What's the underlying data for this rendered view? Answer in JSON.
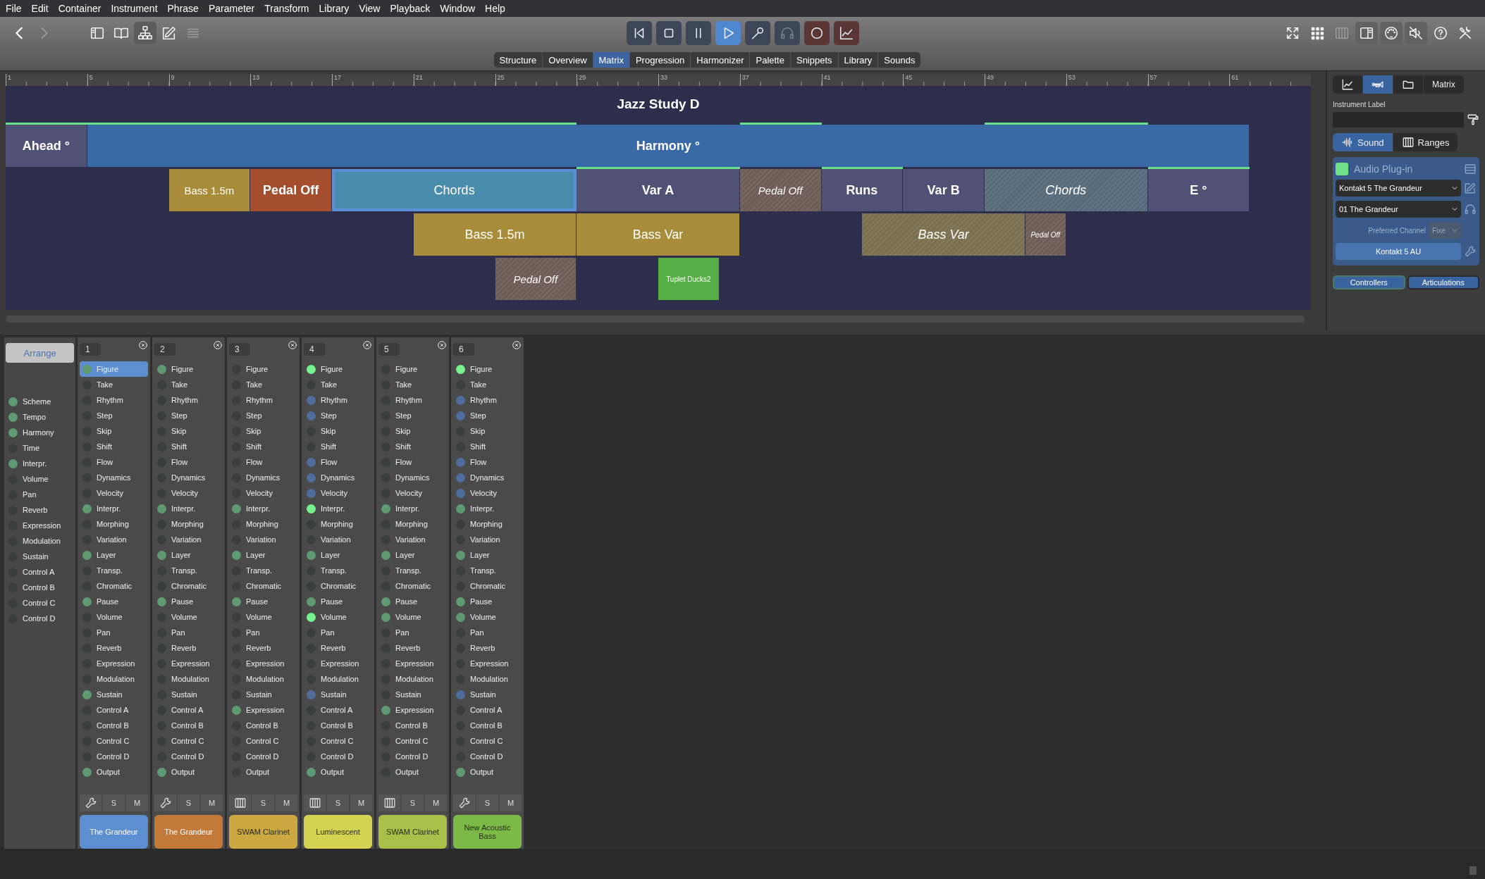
{
  "menu_bar": [
    "File",
    "Edit",
    "Container",
    "Instrument",
    "Phrase",
    "Parameter",
    "Transform",
    "Library",
    "View",
    "Playback",
    "Window",
    "Help"
  ],
  "toolbar": {
    "nav": [
      {
        "disabled": false
      },
      {
        "disabled": true
      }
    ],
    "view_buttons": [
      {
        "selected": false,
        "disabled": false
      },
      {
        "selected": false,
        "disabled": false
      },
      {
        "selected": true,
        "disabled": false
      },
      {
        "selected": false,
        "disabled": false
      },
      {
        "selected": false,
        "disabled": true
      }
    ],
    "transport": [
      {
        "selected": false,
        "disabled": false,
        "armed": false
      },
      {
        "selected": false,
        "disabled": false,
        "armed": false
      },
      {
        "selected": false,
        "disabled": false,
        "armed": false
      },
      {
        "selected": true,
        "disabled": false,
        "armed": false
      },
      {
        "selected": false,
        "disabled": false,
        "armed": false
      },
      {
        "selected": false,
        "disabled": true,
        "armed": false
      },
      {
        "selected": false,
        "disabled": false,
        "armed": true
      },
      {
        "selected": false,
        "disabled": false,
        "armed": true
      }
    ],
    "right_buttons": [
      {
        "selected": false,
        "disabled": false
      },
      {
        "selected": false,
        "disabled": false
      },
      {
        "selected": false,
        "disabled": true
      },
      {
        "selected": true,
        "disabled": false
      },
      {
        "selected": true,
        "disabled": false
      },
      {
        "selected": true,
        "disabled": false
      },
      {
        "selected": false,
        "disabled": false
      },
      {
        "selected": false,
        "disabled": false
      }
    ]
  },
  "tabs": [
    {
      "label": "Structure",
      "selected": false
    },
    {
      "label": "Overview",
      "selected": false
    },
    {
      "label": "Matrix",
      "selected": true
    },
    {
      "label": "Progression",
      "selected": false
    },
    {
      "label": "Harmonizer",
      "selected": false
    },
    {
      "label": "Palette",
      "selected": false
    },
    {
      "label": "Snippets",
      "selected": false
    },
    {
      "label": "Library",
      "selected": false
    },
    {
      "label": "Sounds",
      "selected": false
    }
  ],
  "timeline": {
    "ruler": [
      "1",
      "5",
      "9",
      "13",
      "17",
      "21",
      "25",
      "29",
      "33",
      "37",
      "41",
      "45",
      "49",
      "53",
      "57",
      "61"
    ],
    "title": "Jazz Study D",
    "rows": [
      {
        "blocks": [
          {
            "label": "Ahead °",
            "color": "#4f5275",
            "kind": "section",
            "muted": false,
            "selected": false
          },
          {
            "label": "Harmony °",
            "color": "#3a69a8",
            "kind": "section",
            "muted": false,
            "selected": false
          }
        ]
      },
      {
        "blocks": [
          {
            "label": "Bass 1.5m",
            "color": "#a98c3a",
            "kind": "phrase",
            "muted": false,
            "selected": false
          },
          {
            "label": "Pedal Off",
            "color": "#a44e2e",
            "kind": "section",
            "muted": false,
            "selected": false
          },
          {
            "label": "Chords",
            "color": "#4a8cac",
            "kind": "phrase",
            "muted": false,
            "selected": true
          },
          {
            "label": "Var A",
            "color": "#4f5275",
            "kind": "section",
            "muted": false,
            "selected": false
          },
          {
            "label": "Pedal Off",
            "color": "#6e5c56",
            "kind": "phrase",
            "muted": true,
            "selected": false
          },
          {
            "label": "Runs",
            "color": "#4f5275",
            "kind": "section",
            "muted": false,
            "selected": false
          },
          {
            "label": "Var B",
            "color": "#4f5275",
            "kind": "section",
            "muted": false,
            "selected": false
          },
          {
            "label": "Chords",
            "color": "#566a7a",
            "kind": "phrase",
            "muted": true,
            "selected": false
          },
          {
            "label": "E °",
            "color": "#4f5275",
            "kind": "section",
            "muted": false,
            "selected": false
          }
        ]
      },
      {
        "blocks": [
          {
            "label": "Bass 1.5m",
            "color": "#a98c3a",
            "kind": "phrase",
            "muted": false,
            "selected": false
          },
          {
            "label": "Bass Var",
            "color": "#a98c3a",
            "kind": "phrase",
            "muted": false,
            "selected": false
          },
          {
            "label": "Bass Var",
            "color": "#7a7050",
            "kind": "phrase",
            "muted": true,
            "selected": false
          },
          {
            "label": "Pedal Off",
            "color": "#6e5c56",
            "kind": "small",
            "muted": true,
            "selected": false
          }
        ]
      },
      {
        "blocks": [
          {
            "label": "Pedal Off",
            "color": "#6e5c56",
            "kind": "phrase",
            "muted": true,
            "selected": false
          },
          {
            "label": "Tuplet Ducks2",
            "color": "#54ae44",
            "kind": "small",
            "muted": false,
            "selected": false
          }
        ]
      }
    ]
  },
  "inspector": {
    "tabs": [
      {
        "selected": false
      },
      {
        "selected": true
      },
      {
        "selected": false
      },
      {
        "label": "Matrix",
        "selected": false
      }
    ],
    "label_caption": "Instrument Label",
    "sound_tabs": [
      {
        "label": "Sound",
        "selected": true
      },
      {
        "label": "Ranges",
        "selected": false
      }
    ],
    "plugin": {
      "title": "Audio Plug-in",
      "color": "#6ee08a",
      "instrument": "Kontakt 5 The Grandeur",
      "program": "01 The Grandeur",
      "channel_label": "Preferred Channel",
      "channel_value": "Fixe",
      "plugin_button": "Kontakt 5 AU"
    },
    "bottom_buttons": [
      {
        "label": "Controllers",
        "selected": true
      },
      {
        "label": "Articulations",
        "selected": false
      }
    ]
  },
  "mixer": {
    "arrange_button": "Arrange",
    "global_params": [
      {
        "label": "Scheme",
        "color": "#5f9a73"
      },
      {
        "label": "Tempo",
        "color": "#5f9a73"
      },
      {
        "label": "Harmony",
        "color": "#5f9a73"
      },
      {
        "label": "Time",
        "color": "#3a3f3c"
      },
      {
        "label": "Interpr.",
        "color": "#5f9a73"
      },
      {
        "label": "Volume",
        "color": "#3a3f3c"
      },
      {
        "label": "Pan",
        "color": "#3a3f3c"
      },
      {
        "label": "Reverb",
        "color": "#3a3f3c"
      },
      {
        "label": "Expression",
        "color": "#3a3f3c"
      },
      {
        "label": "Modulation",
        "color": "#3a3f3c"
      },
      {
        "label": "Sustain",
        "color": "#3a3f3c"
      },
      {
        "label": "Control A",
        "color": "#3a3f3c"
      },
      {
        "label": "Control B",
        "color": "#3a3f3c"
      },
      {
        "label": "Control C",
        "color": "#3a3f3c"
      },
      {
        "label": "Control D",
        "color": "#3a3f3c"
      }
    ],
    "channels": [
      {
        "number": "1",
        "kind": "plugin",
        "solo": "S",
        "mute": "M",
        "instrument": "The Grandeur",
        "color": "#5b8fd0",
        "params": [
          {
            "label": "Figure",
            "color": "#5f9a73",
            "selected": true
          },
          {
            "label": "Take",
            "color": "#3a3f3c",
            "selected": false
          },
          {
            "label": "Rhythm",
            "color": "#3a3f3c",
            "selected": false
          },
          {
            "label": "Step",
            "color": "#3a3f3c",
            "selected": false
          },
          {
            "label": "Skip",
            "color": "#3a3f3c",
            "selected": false
          },
          {
            "label": "Shift",
            "color": "#3a3f3c",
            "selected": false
          },
          {
            "label": "Flow",
            "color": "#3a3f3c",
            "selected": false
          },
          {
            "label": "Dynamics",
            "color": "#3a3f3c",
            "selected": false
          },
          {
            "label": "Velocity",
            "color": "#3a3f3c",
            "selected": false
          },
          {
            "label": "Interpr.",
            "color": "#5f9a73",
            "selected": false
          },
          {
            "label": "Morphing",
            "color": "#3a3f3c",
            "selected": false
          },
          {
            "label": "Variation",
            "color": "#3a3f3c",
            "selected": false
          },
          {
            "label": "Layer",
            "color": "#5f9a73",
            "selected": false
          },
          {
            "label": "Transp.",
            "color": "#3a3f3c",
            "selected": false
          },
          {
            "label": "Chromatic",
            "color": "#3a3f3c",
            "selected": false
          },
          {
            "label": "Pause",
            "color": "#5f9a73",
            "selected": false
          },
          {
            "label": "Volume",
            "color": "#3a3f3c",
            "selected": false
          },
          {
            "label": "Pan",
            "color": "#3a3f3c",
            "selected": false
          },
          {
            "label": "Reverb",
            "color": "#3a3f3c",
            "selected": false
          },
          {
            "label": "Expression",
            "color": "#3a3f3c",
            "selected": false
          },
          {
            "label": "Modulation",
            "color": "#3a3f3c",
            "selected": false
          },
          {
            "label": "Sustain",
            "color": "#5f9a73",
            "selected": false
          },
          {
            "label": "Control A",
            "color": "#3a3f3c",
            "selected": false
          },
          {
            "label": "Control B",
            "color": "#3a3f3c",
            "selected": false
          },
          {
            "label": "Control C",
            "color": "#3a3f3c",
            "selected": false
          },
          {
            "label": "Control D",
            "color": "#3a3f3c",
            "selected": false
          },
          {
            "label": "Output",
            "color": "#5f9a73",
            "selected": false
          }
        ]
      },
      {
        "number": "2",
        "kind": "plugin",
        "solo": "S",
        "mute": "M",
        "instrument": "The Grandeur",
        "color": "#c27a3a",
        "params": [
          {
            "label": "Figure",
            "color": "#5f9a73",
            "selected": false
          },
          {
            "label": "Take",
            "color": "#3a3f3c",
            "selected": false
          },
          {
            "label": "Rhythm",
            "color": "#3a3f3c",
            "selected": false
          },
          {
            "label": "Step",
            "color": "#3a3f3c",
            "selected": false
          },
          {
            "label": "Skip",
            "color": "#3a3f3c",
            "selected": false
          },
          {
            "label": "Shift",
            "color": "#3a3f3c",
            "selected": false
          },
          {
            "label": "Flow",
            "color": "#3a3f3c",
            "selected": false
          },
          {
            "label": "Dynamics",
            "color": "#3a3f3c",
            "selected": false
          },
          {
            "label": "Velocity",
            "color": "#3a3f3c",
            "selected": false
          },
          {
            "label": "Interpr.",
            "color": "#5f9a73",
            "selected": false
          },
          {
            "label": "Morphing",
            "color": "#3a3f3c",
            "selected": false
          },
          {
            "label": "Variation",
            "color": "#3a3f3c",
            "selected": false
          },
          {
            "label": "Layer",
            "color": "#5f9a73",
            "selected": false
          },
          {
            "label": "Transp.",
            "color": "#3a3f3c",
            "selected": false
          },
          {
            "label": "Chromatic",
            "color": "#3a3f3c",
            "selected": false
          },
          {
            "label": "Pause",
            "color": "#5f9a73",
            "selected": false
          },
          {
            "label": "Volume",
            "color": "#3a3f3c",
            "selected": false
          },
          {
            "label": "Pan",
            "color": "#3a3f3c",
            "selected": false
          },
          {
            "label": "Reverb",
            "color": "#3a3f3c",
            "selected": false
          },
          {
            "label": "Expression",
            "color": "#3a3f3c",
            "selected": false
          },
          {
            "label": "Modulation",
            "color": "#3a3f3c",
            "selected": false
          },
          {
            "label": "Sustain",
            "color": "#3a3f3c",
            "selected": false
          },
          {
            "label": "Control A",
            "color": "#3a3f3c",
            "selected": false
          },
          {
            "label": "Control B",
            "color": "#3a3f3c",
            "selected": false
          },
          {
            "label": "Control C",
            "color": "#3a3f3c",
            "selected": false
          },
          {
            "label": "Control D",
            "color": "#3a3f3c",
            "selected": false
          },
          {
            "label": "Output",
            "color": "#5f9a73",
            "selected": false
          }
        ]
      },
      {
        "number": "3",
        "kind": "midi",
        "solo": "S",
        "mute": "M",
        "instrument": "SWAM Clarinet",
        "color": "#cca840",
        "params": [
          {
            "label": "Figure",
            "color": "#3a3f3c",
            "selected": false
          },
          {
            "label": "Take",
            "color": "#3a3f3c",
            "selected": false
          },
          {
            "label": "Rhythm",
            "color": "#3a3f3c",
            "selected": false
          },
          {
            "label": "Step",
            "color": "#3a3f3c",
            "selected": false
          },
          {
            "label": "Skip",
            "color": "#3a3f3c",
            "selected": false
          },
          {
            "label": "Shift",
            "color": "#3a3f3c",
            "selected": false
          },
          {
            "label": "Flow",
            "color": "#3a3f3c",
            "selected": false
          },
          {
            "label": "Dynamics",
            "color": "#3a3f3c",
            "selected": false
          },
          {
            "label": "Velocity",
            "color": "#3a3f3c",
            "selected": false
          },
          {
            "label": "Interpr.",
            "color": "#5f9a73",
            "selected": false
          },
          {
            "label": "Morphing",
            "color": "#3a3f3c",
            "selected": false
          },
          {
            "label": "Variation",
            "color": "#3a3f3c",
            "selected": false
          },
          {
            "label": "Layer",
            "color": "#5f9a73",
            "selected": false
          },
          {
            "label": "Transp.",
            "color": "#3a3f3c",
            "selected": false
          },
          {
            "label": "Chromatic",
            "color": "#3a3f3c",
            "selected": false
          },
          {
            "label": "Pause",
            "color": "#5f9a73",
            "selected": false
          },
          {
            "label": "Volume",
            "color": "#3a3f3c",
            "selected": false
          },
          {
            "label": "Pan",
            "color": "#3a3f3c",
            "selected": false
          },
          {
            "label": "Reverb",
            "color": "#3a3f3c",
            "selected": false
          },
          {
            "label": "Expression",
            "color": "#3a3f3c",
            "selected": false
          },
          {
            "label": "Modulation",
            "color": "#3a3f3c",
            "selected": false
          },
          {
            "label": "Sustain",
            "color": "#3a3f3c",
            "selected": false
          },
          {
            "label": "Expression",
            "color": "#5f9a73",
            "selected": false
          },
          {
            "label": "Control B",
            "color": "#3a3f3c",
            "selected": false
          },
          {
            "label": "Control C",
            "color": "#3a3f3c",
            "selected": false
          },
          {
            "label": "Control D",
            "color": "#3a3f3c",
            "selected": false
          },
          {
            "label": "Output",
            "color": "#3a3f3c",
            "selected": false
          }
        ]
      },
      {
        "number": "4",
        "kind": "midi",
        "solo": "S",
        "mute": "M",
        "instrument": "Luminescent",
        "color": "#d4d250",
        "params": [
          {
            "label": "Figure",
            "color": "#76f28e",
            "selected": false
          },
          {
            "label": "Take",
            "color": "#3a3f3c",
            "selected": false
          },
          {
            "label": "Rhythm",
            "color": "#4e6c9c",
            "selected": false
          },
          {
            "label": "Step",
            "color": "#4e6c9c",
            "selected": false
          },
          {
            "label": "Skip",
            "color": "#3a3f3c",
            "selected": false
          },
          {
            "label": "Shift",
            "color": "#3a3f3c",
            "selected": false
          },
          {
            "label": "Flow",
            "color": "#4e6c9c",
            "selected": false
          },
          {
            "label": "Dynamics",
            "color": "#4e6c9c",
            "selected": false
          },
          {
            "label": "Velocity",
            "color": "#4e6c9c",
            "selected": false
          },
          {
            "label": "Interpr.",
            "color": "#76f28e",
            "selected": false
          },
          {
            "label": "Morphing",
            "color": "#3a3f3c",
            "selected": false
          },
          {
            "label": "Variation",
            "color": "#3a3f3c",
            "selected": false
          },
          {
            "label": "Layer",
            "color": "#5f9a73",
            "selected": false
          },
          {
            "label": "Transp.",
            "color": "#3a3f3c",
            "selected": false
          },
          {
            "label": "Chromatic",
            "color": "#3a3f3c",
            "selected": false
          },
          {
            "label": "Pause",
            "color": "#5f9a73",
            "selected": false
          },
          {
            "label": "Volume",
            "color": "#76f28e",
            "selected": false
          },
          {
            "label": "Pan",
            "color": "#3a3f3c",
            "selected": false
          },
          {
            "label": "Reverb",
            "color": "#3a3f3c",
            "selected": false
          },
          {
            "label": "Expression",
            "color": "#3a3f3c",
            "selected": false
          },
          {
            "label": "Modulation",
            "color": "#3a3f3c",
            "selected": false
          },
          {
            "label": "Sustain",
            "color": "#4e6c9c",
            "selected": false
          },
          {
            "label": "Control A",
            "color": "#3a3f3c",
            "selected": false
          },
          {
            "label": "Control B",
            "color": "#3a3f3c",
            "selected": false
          },
          {
            "label": "Control C",
            "color": "#3a3f3c",
            "selected": false
          },
          {
            "label": "Control D",
            "color": "#3a3f3c",
            "selected": false
          },
          {
            "label": "Output",
            "color": "#5f9a73",
            "selected": false
          }
        ]
      },
      {
        "number": "5",
        "kind": "midi",
        "solo": "S",
        "mute": "M",
        "instrument": "SWAM Clarinet",
        "color": "#a8c04a",
        "params": [
          {
            "label": "Figure",
            "color": "#3a3f3c",
            "selected": false
          },
          {
            "label": "Take",
            "color": "#3a3f3c",
            "selected": false
          },
          {
            "label": "Rhythm",
            "color": "#3a3f3c",
            "selected": false
          },
          {
            "label": "Step",
            "color": "#3a3f3c",
            "selected": false
          },
          {
            "label": "Skip",
            "color": "#3a3f3c",
            "selected": false
          },
          {
            "label": "Shift",
            "color": "#3a3f3c",
            "selected": false
          },
          {
            "label": "Flow",
            "color": "#3a3f3c",
            "selected": false
          },
          {
            "label": "Dynamics",
            "color": "#3a3f3c",
            "selected": false
          },
          {
            "label": "Velocity",
            "color": "#3a3f3c",
            "selected": false
          },
          {
            "label": "Interpr.",
            "color": "#5f9a73",
            "selected": false
          },
          {
            "label": "Morphing",
            "color": "#3a3f3c",
            "selected": false
          },
          {
            "label": "Variation",
            "color": "#3a3f3c",
            "selected": false
          },
          {
            "label": "Layer",
            "color": "#5f9a73",
            "selected": false
          },
          {
            "label": "Transp.",
            "color": "#3a3f3c",
            "selected": false
          },
          {
            "label": "Chromatic",
            "color": "#3a3f3c",
            "selected": false
          },
          {
            "label": "Pause",
            "color": "#5f9a73",
            "selected": false
          },
          {
            "label": "Volume",
            "color": "#5f9a73",
            "selected": false
          },
          {
            "label": "Pan",
            "color": "#3a3f3c",
            "selected": false
          },
          {
            "label": "Reverb",
            "color": "#3a3f3c",
            "selected": false
          },
          {
            "label": "Expression",
            "color": "#3a3f3c",
            "selected": false
          },
          {
            "label": "Modulation",
            "color": "#3a3f3c",
            "selected": false
          },
          {
            "label": "Sustain",
            "color": "#3a3f3c",
            "selected": false
          },
          {
            "label": "Expression",
            "color": "#5f9a73",
            "selected": false
          },
          {
            "label": "Control B",
            "color": "#3a3f3c",
            "selected": false
          },
          {
            "label": "Control C",
            "color": "#3a3f3c",
            "selected": false
          },
          {
            "label": "Control D",
            "color": "#3a3f3c",
            "selected": false
          },
          {
            "label": "Output",
            "color": "#3a3f3c",
            "selected": false
          }
        ]
      },
      {
        "number": "6",
        "kind": "plugin",
        "solo": "S",
        "mute": "M",
        "instrument": "New Acoustic Bass",
        "color": "#7cba48",
        "params": [
          {
            "label": "Figure",
            "color": "#76f28e",
            "selected": false
          },
          {
            "label": "Take",
            "color": "#3a3f3c",
            "selected": false
          },
          {
            "label": "Rhythm",
            "color": "#4e6c9c",
            "selected": false
          },
          {
            "label": "Step",
            "color": "#4e6c9c",
            "selected": false
          },
          {
            "label": "Skip",
            "color": "#3a3f3c",
            "selected": false
          },
          {
            "label": "Shift",
            "color": "#3a3f3c",
            "selected": false
          },
          {
            "label": "Flow",
            "color": "#4e6c9c",
            "selected": false
          },
          {
            "label": "Dynamics",
            "color": "#4e6c9c",
            "selected": false
          },
          {
            "label": "Velocity",
            "color": "#4e6c9c",
            "selected": false
          },
          {
            "label": "Interpr.",
            "color": "#5f9a73",
            "selected": false
          },
          {
            "label": "Morphing",
            "color": "#3a3f3c",
            "selected": false
          },
          {
            "label": "Variation",
            "color": "#3a3f3c",
            "selected": false
          },
          {
            "label": "Layer",
            "color": "#5f9a73",
            "selected": false
          },
          {
            "label": "Transp.",
            "color": "#3a3f3c",
            "selected": false
          },
          {
            "label": "Chromatic",
            "color": "#3a3f3c",
            "selected": false
          },
          {
            "label": "Pause",
            "color": "#5f9a73",
            "selected": false
          },
          {
            "label": "Volume",
            "color": "#5f9a73",
            "selected": false
          },
          {
            "label": "Pan",
            "color": "#3a3f3c",
            "selected": false
          },
          {
            "label": "Reverb",
            "color": "#3a3f3c",
            "selected": false
          },
          {
            "label": "Expression",
            "color": "#3a3f3c",
            "selected": false
          },
          {
            "label": "Modulation",
            "color": "#3a3f3c",
            "selected": false
          },
          {
            "label": "Sustain",
            "color": "#4e6c9c",
            "selected": false
          },
          {
            "label": "Control A",
            "color": "#3a3f3c",
            "selected": false
          },
          {
            "label": "Control B",
            "color": "#3a3f3c",
            "selected": false
          },
          {
            "label": "Control C",
            "color": "#3a3f3c",
            "selected": false
          },
          {
            "label": "Control D",
            "color": "#3a3f3c",
            "selected": false
          },
          {
            "label": "Output",
            "color": "#5f9a73",
            "selected": false
          }
        ]
      }
    ]
  }
}
